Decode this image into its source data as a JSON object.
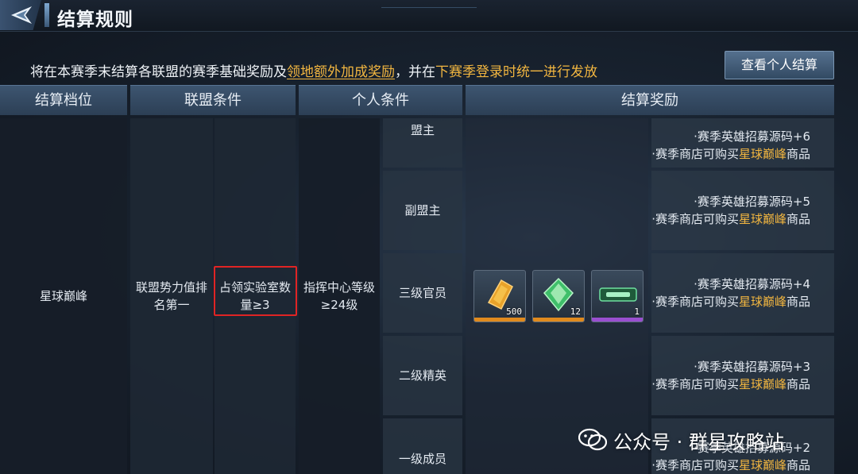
{
  "header": {
    "title": "结算规则",
    "back_icon": "back-arrow-icon"
  },
  "notice": {
    "part1": "将在本赛季末结算各联盟的赛季基础奖励及",
    "link": "领地额外加成奖励",
    "part2": "，并在",
    "highlight": "下赛季登录时统一进行发放"
  },
  "view_button": {
    "label": "查看个人结算"
  },
  "table": {
    "headers": [
      "结算档位",
      "联盟条件",
      "个人条件",
      "结算奖励"
    ],
    "tier": "星球巅峰",
    "alliance_condition_1": "联盟势力值排名第一",
    "alliance_condition_2": "占领实验室数量≥3",
    "personal_condition": "指挥中心等级≥24级",
    "ranks": [
      {
        "rank": "盟主",
        "reward_line1": "·赛季英雄招募源码+6",
        "reward_line2_pre": "·赛季商店可购买",
        "reward_line2_gold": "星球巅峰",
        "reward_line2_post": "商品"
      },
      {
        "rank": "副盟主",
        "reward_line1": "·赛季英雄招募源码+5",
        "reward_line2_pre": "·赛季商店可购买",
        "reward_line2_gold": "星球巅峰",
        "reward_line2_post": "商品"
      },
      {
        "rank": "三级官员",
        "reward_line1": "·赛季英雄招募源码+4",
        "reward_line2_pre": "·赛季商店可购买",
        "reward_line2_gold": "星球巅峰",
        "reward_line2_post": "商品"
      },
      {
        "rank": "二级精英",
        "reward_line1": "·赛季英雄招募源码+3",
        "reward_line2_pre": "·赛季商店可购买",
        "reward_line2_gold": "星球巅峰",
        "reward_line2_post": "商品"
      },
      {
        "rank": "一级成员",
        "reward_line1": "·赛季英雄招募源码+2",
        "reward_line2_pre": "·赛季商店可购买",
        "reward_line2_gold": "星球巅峰",
        "reward_line2_post": "商品"
      }
    ],
    "items": [
      {
        "icon": "gold-crystal-icon",
        "qty": "500",
        "rarity_color": "#e08a1e"
      },
      {
        "icon": "green-crystal-icon",
        "qty": "12",
        "rarity_color": "#e08a1e"
      },
      {
        "icon": "emblem-plate-icon",
        "qty": "1",
        "rarity_color": "#9a4fd0"
      }
    ]
  },
  "watermark": {
    "text": "公众号 · 群星攻略站",
    "icon": "wechat-icon"
  }
}
